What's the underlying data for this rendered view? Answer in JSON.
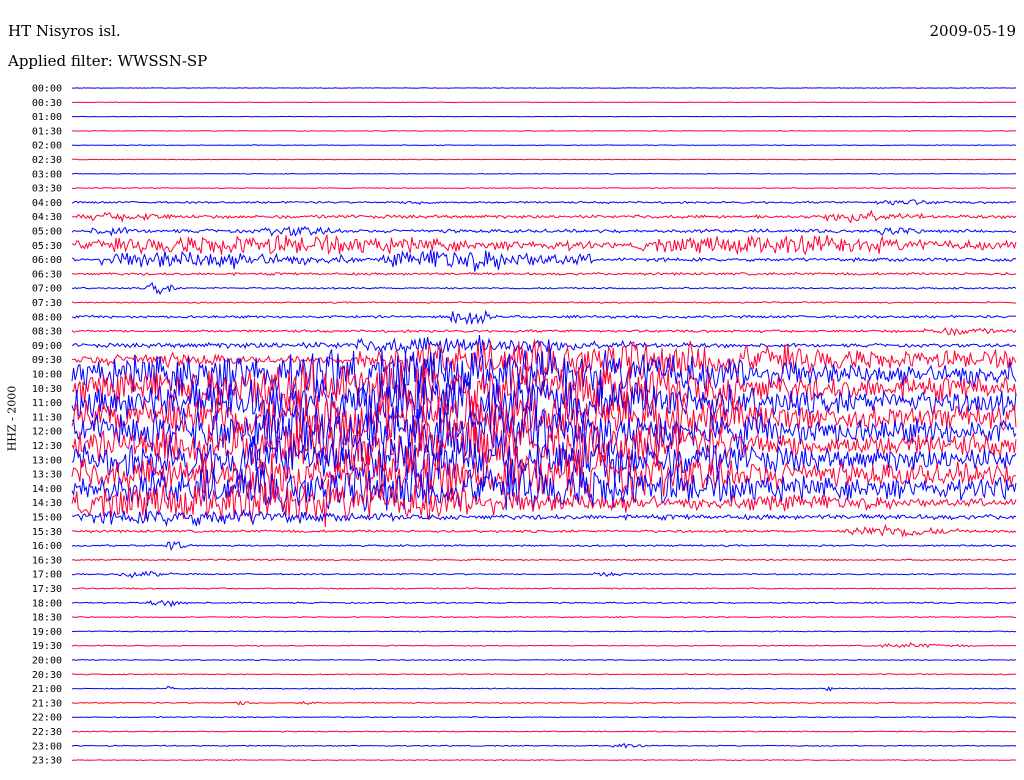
{
  "header": {
    "station": "HT Nisyros isl.",
    "date": "2009-05-19",
    "filter": "Applied filter: WWSSN-SP",
    "channel": "HHZ  -  2000"
  },
  "colors": {
    "trace_a": "#0000ff",
    "trace_b": "#ff0033"
  },
  "chart_data": {
    "type": "helicorder",
    "title": "HT Nisyros isl.",
    "date": "2009-05-19",
    "filter": "WWSSN-SP",
    "ylabel": "HHZ  -  2000",
    "rows": [
      {
        "label": "00:00",
        "amp": 0.3,
        "events": []
      },
      {
        "label": "00:30",
        "amp": 0.3,
        "events": []
      },
      {
        "label": "01:00",
        "amp": 0.3,
        "events": []
      },
      {
        "label": "01:30",
        "amp": 0.4,
        "events": []
      },
      {
        "label": "02:00",
        "amp": 0.4,
        "events": []
      },
      {
        "label": "02:30",
        "amp": 0.4,
        "events": []
      },
      {
        "label": "03:00",
        "amp": 0.4,
        "events": []
      },
      {
        "label": "03:30",
        "amp": 0.5,
        "events": []
      },
      {
        "label": "04:00",
        "amp": 1.2,
        "events": [
          [
            0.35,
            0.05,
            3
          ],
          [
            0.85,
            0.08,
            4
          ]
        ]
      },
      {
        "label": "04:30",
        "amp": 2.0,
        "events": [
          [
            0.0,
            0.15,
            5
          ],
          [
            0.8,
            0.1,
            8
          ]
        ]
      },
      {
        "label": "05:00",
        "amp": 2.0,
        "events": [
          [
            0.02,
            0.05,
            6
          ],
          [
            0.2,
            0.1,
            6
          ],
          [
            0.85,
            0.05,
            6
          ]
        ]
      },
      {
        "label": "05:30",
        "amp": 3.0,
        "events": [
          [
            0.0,
            0.55,
            12
          ],
          [
            0.6,
            0.4,
            12
          ]
        ]
      },
      {
        "label": "06:00",
        "amp": 2.0,
        "events": [
          [
            0.03,
            0.27,
            12
          ],
          [
            0.33,
            0.22,
            14
          ]
        ]
      },
      {
        "label": "06:30",
        "amp": 1.5,
        "events": []
      },
      {
        "label": "07:00",
        "amp": 1.0,
        "events": [
          [
            0.08,
            0.03,
            10
          ]
        ]
      },
      {
        "label": "07:30",
        "amp": 0.8,
        "events": []
      },
      {
        "label": "08:00",
        "amp": 1.5,
        "events": [
          [
            0.4,
            0.05,
            12
          ]
        ]
      },
      {
        "label": "08:30",
        "amp": 1.5,
        "events": [
          [
            0.9,
            0.1,
            5
          ]
        ]
      },
      {
        "label": "09:00",
        "amp": 2.0,
        "events": [
          [
            0.0,
            1.0,
            4
          ],
          [
            0.3,
            0.3,
            12
          ]
        ]
      },
      {
        "label": "09:30",
        "amp": 4.0,
        "events": [
          [
            0.0,
            0.25,
            8
          ],
          [
            0.3,
            0.7,
            24
          ]
        ]
      },
      {
        "label": "10:00",
        "amp": 4.0,
        "events": [
          [
            0.0,
            1.0,
            30
          ]
        ]
      },
      {
        "label": "10:30",
        "amp": 4.0,
        "events": [
          [
            0.0,
            1.0,
            32
          ]
        ]
      },
      {
        "label": "11:00",
        "amp": 4.0,
        "events": [
          [
            0.0,
            1.0,
            32
          ]
        ]
      },
      {
        "label": "11:30",
        "amp": 4.0,
        "events": [
          [
            0.0,
            1.0,
            32
          ]
        ]
      },
      {
        "label": "12:00",
        "amp": 4.0,
        "events": [
          [
            0.0,
            1.0,
            32
          ]
        ]
      },
      {
        "label": "12:30",
        "amp": 4.0,
        "events": [
          [
            0.0,
            1.0,
            30
          ]
        ]
      },
      {
        "label": "13:00",
        "amp": 4.0,
        "events": [
          [
            0.0,
            1.0,
            30
          ]
        ]
      },
      {
        "label": "13:30",
        "amp": 4.0,
        "events": [
          [
            0.0,
            1.0,
            30
          ]
        ]
      },
      {
        "label": "14:00",
        "amp": 4.0,
        "events": [
          [
            0.0,
            1.0,
            28
          ]
        ]
      },
      {
        "label": "14:30",
        "amp": 4.0,
        "events": [
          [
            0.0,
            0.62,
            26
          ],
          [
            0.62,
            0.38,
            10
          ]
        ]
      },
      {
        "label": "15:00",
        "amp": 3.0,
        "events": [
          [
            0.0,
            0.35,
            10
          ]
        ]
      },
      {
        "label": "15:30",
        "amp": 1.5,
        "events": [
          [
            0.82,
            0.12,
            8
          ]
        ]
      },
      {
        "label": "16:00",
        "amp": 1.0,
        "events": [
          [
            0.1,
            0.02,
            10
          ]
        ]
      },
      {
        "label": "16:30",
        "amp": 0.8,
        "events": []
      },
      {
        "label": "17:00",
        "amp": 0.8,
        "events": [
          [
            0.05,
            0.06,
            4
          ],
          [
            0.55,
            0.05,
            3
          ]
        ]
      },
      {
        "label": "17:30",
        "amp": 0.8,
        "events": []
      },
      {
        "label": "18:00",
        "amp": 0.8,
        "events": [
          [
            0.08,
            0.05,
            4
          ]
        ]
      },
      {
        "label": "18:30",
        "amp": 0.6,
        "events": []
      },
      {
        "label": "19:00",
        "amp": 0.6,
        "events": []
      },
      {
        "label": "19:30",
        "amp": 0.6,
        "events": [
          [
            0.85,
            0.1,
            3
          ]
        ]
      },
      {
        "label": "20:00",
        "amp": 0.6,
        "events": []
      },
      {
        "label": "20:30",
        "amp": 0.6,
        "events": []
      },
      {
        "label": "21:00",
        "amp": 0.6,
        "events": [
          [
            0.1,
            0.01,
            4
          ],
          [
            0.8,
            0.01,
            5
          ],
          [
            0.9,
            0.01,
            5
          ]
        ]
      },
      {
        "label": "21:30",
        "amp": 0.6,
        "events": [
          [
            0.17,
            0.03,
            3
          ],
          [
            0.24,
            0.02,
            3
          ]
        ]
      },
      {
        "label": "22:00",
        "amp": 0.6,
        "events": []
      },
      {
        "label": "22:30",
        "amp": 0.6,
        "events": []
      },
      {
        "label": "23:00",
        "amp": 0.6,
        "events": [
          [
            0.57,
            0.04,
            3
          ]
        ]
      },
      {
        "label": "23:30",
        "amp": 0.5,
        "events": []
      }
    ]
  }
}
